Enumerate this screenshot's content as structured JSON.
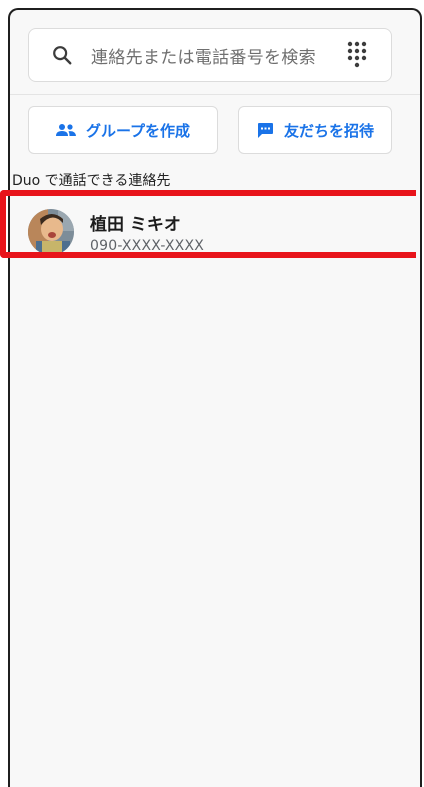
{
  "search": {
    "placeholder": "連絡先または電話番号を検索",
    "icon": "search-icon",
    "dialpad_icon": "dialpad-icon"
  },
  "actions": {
    "create_group_label": "グループを作成",
    "invite_friends_label": "友だちを招待"
  },
  "section": {
    "title": "Duo で通話できる連絡先"
  },
  "contacts": [
    {
      "name": "植田 ミキオ",
      "phone": "090-XXXX-XXXX"
    }
  ],
  "colors": {
    "accent": "#1a73e8",
    "highlight": "#e8141b",
    "background": "#f8f8f8"
  }
}
